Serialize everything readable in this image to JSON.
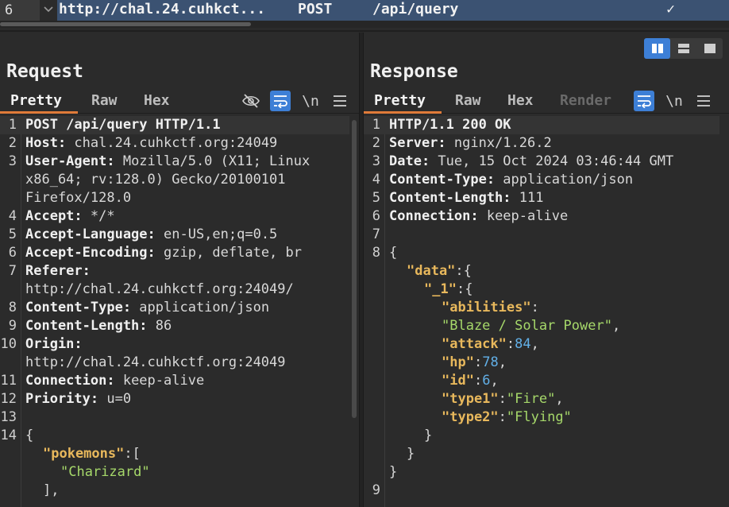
{
  "history": {
    "number": "6",
    "host": "http://chal.24.cuhkct...",
    "method": "POST",
    "path": "/api/query"
  },
  "request": {
    "title": "Request",
    "tabs": [
      "Pretty",
      "Raw",
      "Hex"
    ],
    "newline_label": "\\n",
    "lines": [
      {
        "n": "1",
        "key": "POST /api/query HTTP/1.1",
        "val": ""
      },
      {
        "n": "2",
        "key": "Host:",
        "val": " chal.24.cuhkctf.org:24049"
      },
      {
        "n": "3",
        "key": "User-Agent:",
        "val": " Mozilla/5.0 (X11; Linux"
      },
      {
        "n": "",
        "key": "",
        "val": "x86_64; rv:128.0) Gecko/20100101"
      },
      {
        "n": "",
        "key": "",
        "val": "Firefox/128.0"
      },
      {
        "n": "4",
        "key": "Accept:",
        "val": " */*"
      },
      {
        "n": "5",
        "key": "Accept-Language:",
        "val": " en-US,en;q=0.5"
      },
      {
        "n": "6",
        "key": "Accept-Encoding:",
        "val": " gzip, deflate, br"
      },
      {
        "n": "7",
        "key": "Referer:",
        "val": ""
      },
      {
        "n": "",
        "key": "",
        "val": "http://chal.24.cuhkctf.org:24049/"
      },
      {
        "n": "8",
        "key": "Content-Type:",
        "val": " application/json"
      },
      {
        "n": "9",
        "key": "Content-Length:",
        "val": " 86"
      },
      {
        "n": "10",
        "key": "Origin:",
        "val": ""
      },
      {
        "n": "",
        "key": "",
        "val": "http://chal.24.cuhkctf.org:24049"
      },
      {
        "n": "11",
        "key": "Connection:",
        "val": " keep-alive"
      },
      {
        "n": "12",
        "key": "Priority:",
        "val": " u=0"
      },
      {
        "n": "13",
        "key": "",
        "val": ""
      },
      {
        "n": "14",
        "key": "",
        "val": "{"
      }
    ],
    "body": {
      "key": "\"pokemons\"",
      "open": ":[",
      "item": "\"Charizard\"",
      "close": "],"
    }
  },
  "response": {
    "title": "Response",
    "tabs": [
      "Pretty",
      "Raw",
      "Hex",
      "Render"
    ],
    "newline_label": "\\n",
    "lines": [
      {
        "n": "1",
        "key": "HTTP/1.1 200 OK",
        "val": ""
      },
      {
        "n": "2",
        "key": "Server:",
        "val": " nginx/1.26.2"
      },
      {
        "n": "3",
        "key": "Date:",
        "val": " Tue, 15 Oct 2024 03:46:44 GMT"
      },
      {
        "n": "4",
        "key": "Content-Type:",
        "val": " application/json"
      },
      {
        "n": "5",
        "key": "Content-Length:",
        "val": " 111"
      },
      {
        "n": "6",
        "key": "Connection:",
        "val": " keep-alive"
      },
      {
        "n": "7",
        "key": "",
        "val": ""
      },
      {
        "n": "8",
        "key": "",
        "val": "{"
      }
    ],
    "json": {
      "data_key": "\"data\"",
      "data_open": ":{",
      "one_key": "\"_1\"",
      "one_open": ":{",
      "abilities_key": "\"abilities\"",
      "abilities_colon": ":",
      "abilities_val": "\"Blaze / Solar Power\"",
      "attack_key": "\"attack\"",
      "attack_val": "84",
      "hp_key": "\"hp\"",
      "hp_val": "78",
      "id_key": "\"id\"",
      "id_val": "6",
      "type1_key": "\"type1\"",
      "type1_val": "\"Fire\"",
      "type2_key": "\"type2\"",
      "type2_val": "\"Flying\"",
      "close_inner": "}",
      "close_mid": "}",
      "close_outer": "}",
      "last_line_no": "9"
    }
  }
}
